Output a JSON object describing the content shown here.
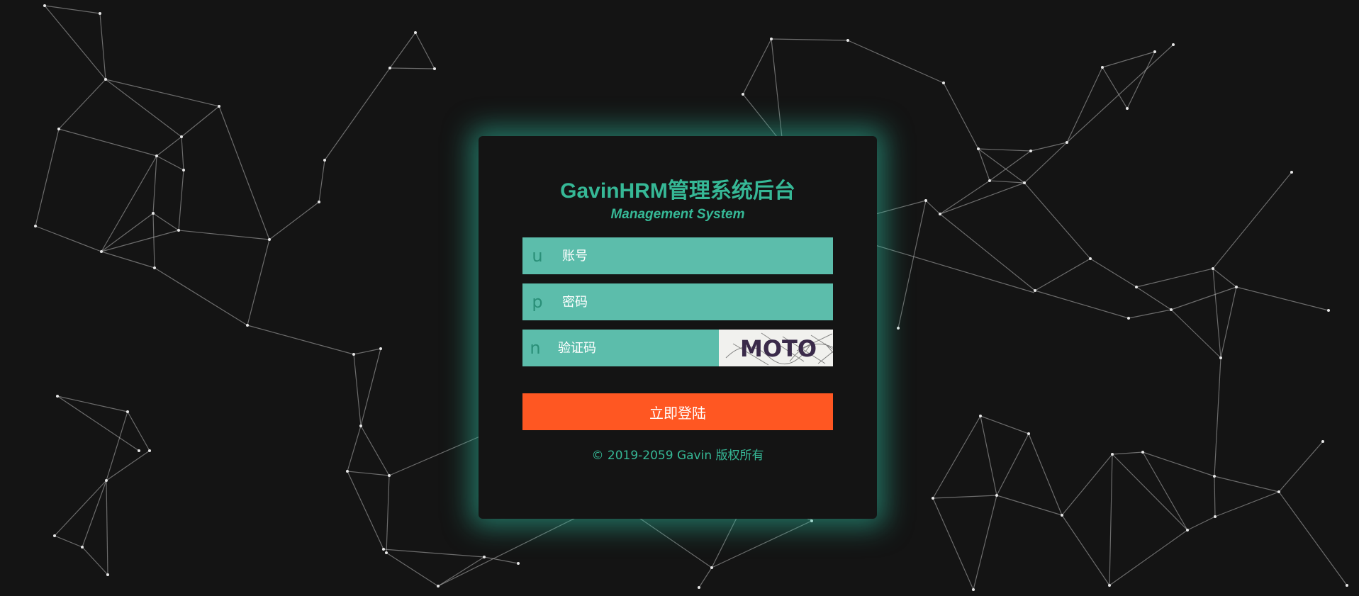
{
  "login": {
    "title": "GavinHRM管理系统后台",
    "subtitle": "Management System",
    "username": {
      "prefix": "u",
      "placeholder": "账号",
      "value": ""
    },
    "password": {
      "prefix": "p",
      "placeholder": "密码",
      "value": ""
    },
    "captcha": {
      "prefix": "n",
      "placeholder": "验证码",
      "value": "",
      "image_text": "MOTO"
    },
    "submit_label": "立即登陆",
    "copyright": "© 2019-2059 Gavin 版权所有"
  },
  "colors": {
    "background": "#141414",
    "accent": "#36b896",
    "field_bg": "#5cbdab",
    "button": "#ff5722",
    "glow": "#2ebea0"
  }
}
